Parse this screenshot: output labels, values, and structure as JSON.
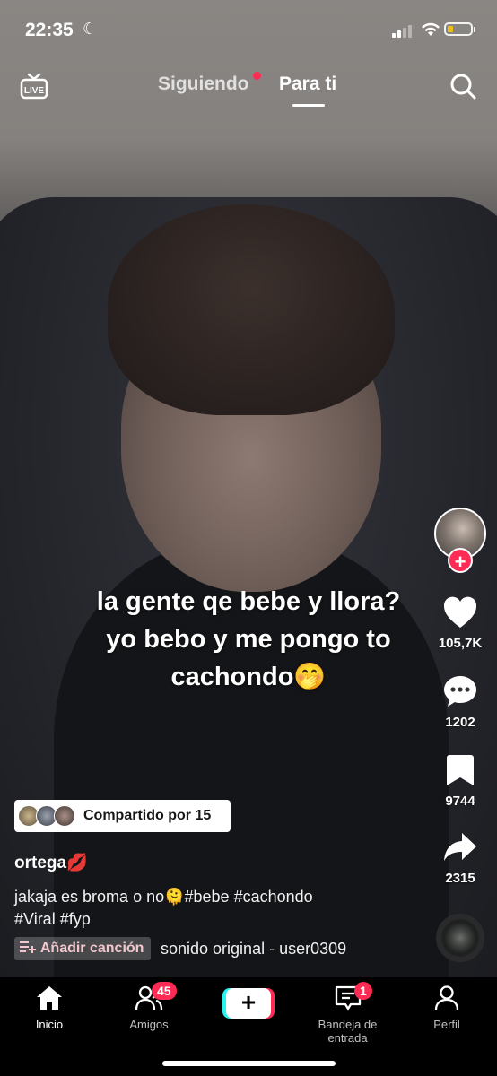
{
  "status_bar": {
    "time": "22:35",
    "moon": "☾"
  },
  "top_nav": {
    "live_label": "LIVE",
    "tabs": [
      {
        "label": "Siguiendo"
      },
      {
        "label": "Para ti"
      }
    ]
  },
  "video": {
    "caption_lines": [
      "la gente qe bebe y llora?",
      "yo bebo y me pongo to",
      "cachondo🤭"
    ]
  },
  "actions": {
    "follow_symbol": "+",
    "likes": "105,7K",
    "comments": "1202",
    "saves": "9744",
    "shares": "2315"
  },
  "post": {
    "shared_label": "Compartido por 15",
    "username": "ortega💋",
    "description_line1": "jakaja es broma o no🫠#bebe #cachondo",
    "description_line2": "#Viral #fyp",
    "add_song": "Añadir canción",
    "sound": "sonido original - user0309"
  },
  "bottom_nav": {
    "items": [
      {
        "label": "Inicio"
      },
      {
        "label": "Amigos",
        "badge": "45"
      },
      {
        "label": "+"
      },
      {
        "label": "Bandeja de entrada",
        "badge": "1"
      },
      {
        "label": "Perfil"
      }
    ]
  },
  "colors": {
    "accent": "#fe2c55",
    "cyan": "#25f4ee",
    "battery": "#f5c518"
  }
}
